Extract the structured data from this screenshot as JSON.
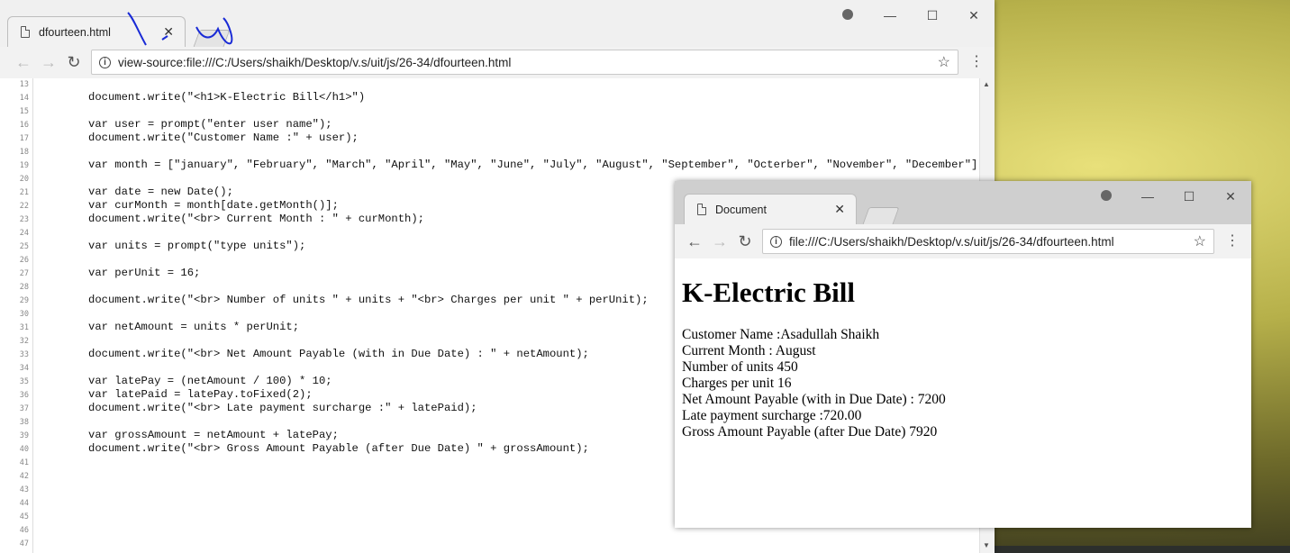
{
  "source_window": {
    "tab_title": "dfourteen.html",
    "url": "view-source:file:///C:/Users/shaikh/Desktop/v.s/uit/js/26-34/dfourteen.html",
    "lines": [
      {
        "n": "13",
        "code": ""
      },
      {
        "n": "14",
        "code": "document.write(\"<h1>K-Electric Bill</h1>\")"
      },
      {
        "n": "15",
        "code": ""
      },
      {
        "n": "16",
        "code": "var user = prompt(\"enter user name\");"
      },
      {
        "n": "17",
        "code": "document.write(\"Customer Name :\" + user);"
      },
      {
        "n": "18",
        "code": ""
      },
      {
        "n": "19",
        "code": "var month = [\"january\", \"February\", \"March\", \"April\", \"May\", \"June\", \"July\", \"August\", \"September\", \"Octerber\", \"November\", \"December\"];"
      },
      {
        "n": "20",
        "code": ""
      },
      {
        "n": "21",
        "code": "var date = new Date();"
      },
      {
        "n": "22",
        "code": "var curMonth = month[date.getMonth()];"
      },
      {
        "n": "23",
        "code": "document.write(\"<br> Current Month : \" + curMonth);"
      },
      {
        "n": "24",
        "code": ""
      },
      {
        "n": "25",
        "code": "var units = prompt(\"type units\");"
      },
      {
        "n": "26",
        "code": ""
      },
      {
        "n": "27",
        "code": "var perUnit = 16;"
      },
      {
        "n": "28",
        "code": ""
      },
      {
        "n": "29",
        "code": "document.write(\"<br> Number of units \" + units + \"<br> Charges per unit \" + perUnit);"
      },
      {
        "n": "30",
        "code": ""
      },
      {
        "n": "31",
        "code": "var netAmount = units * perUnit;"
      },
      {
        "n": "32",
        "code": ""
      },
      {
        "n": "33",
        "code": "document.write(\"<br> Net Amount Payable (with in Due Date) : \" + netAmount);"
      },
      {
        "n": "34",
        "code": ""
      },
      {
        "n": "35",
        "code": "var latePay = (netAmount / 100) * 10;"
      },
      {
        "n": "36",
        "code": "var latePaid = latePay.toFixed(2);"
      },
      {
        "n": "37",
        "code": "document.write(\"<br> Late payment surcharge :\" + latePaid);"
      },
      {
        "n": "38",
        "code": ""
      },
      {
        "n": "39",
        "code": "var grossAmount = netAmount + latePay;"
      },
      {
        "n": "40",
        "code": "document.write(\"<br> Gross Amount Payable (after Due Date) \" + grossAmount);"
      },
      {
        "n": "41",
        "code": ""
      },
      {
        "n": "42",
        "code": ""
      },
      {
        "n": "43",
        "code": ""
      },
      {
        "n": "44",
        "code": ""
      },
      {
        "n": "45",
        "code": ""
      },
      {
        "n": "46",
        "code": ""
      },
      {
        "n": "47",
        "code": ""
      }
    ]
  },
  "render_window": {
    "tab_title": "Document",
    "url": "file:///C:/Users/shaikh/Desktop/v.s/uit/js/26-34/dfourteen.html",
    "heading": "K-Electric Bill",
    "output_lines": [
      "Customer Name :Asadullah Shaikh",
      "Current Month : August",
      "Number of units 450",
      "Charges per unit 16",
      "Net Amount Payable (with in Due Date) : 7200",
      "Late payment surcharge :720.00",
      "Gross Amount Payable (after Due Date) 7920"
    ]
  },
  "icons": {
    "back": "back-arrow-icon",
    "forward": "forward-arrow-icon",
    "reload": "reload-icon",
    "info": "info-icon",
    "star": "bookmark-star-icon",
    "menu": "kebab-menu-icon",
    "profile": "profile-icon",
    "minimize": "minimize-icon",
    "maximize": "maximize-icon",
    "close": "close-icon"
  },
  "colors": {
    "annotation_ink": "#1a2bd6"
  }
}
